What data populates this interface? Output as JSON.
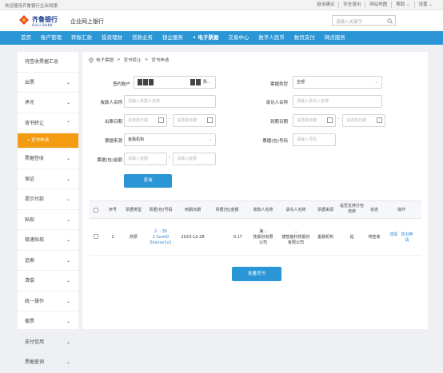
{
  "topbar": {
    "welcome": "欢迎使用齐鲁银行企业网银",
    "links": [
      "投诉建议",
      "安全退出",
      "网站地图",
      "帮助 ⌄",
      "设置 ⌄"
    ]
  },
  "brand": {
    "name_cn": "齐鲁银行",
    "name_en": "QILU BANK",
    "site_title": "企业网上银行",
    "search_placeholder": "请输入关键字"
  },
  "nav": {
    "items": [
      "首页",
      "账户管理",
      "转账汇款",
      "投资理财",
      "贷款业务",
      "银企服务",
      "• 电子票据",
      "交易中心",
      "数字人民币",
      "数贸支付",
      "网点服务"
    ],
    "active_index": 6
  },
  "sidebar": {
    "items": [
      {
        "label": "待签收票据汇总",
        "chev": ""
      },
      {
        "label": "出票",
        "chev": "⌄"
      },
      {
        "label": "承兑",
        "chev": "⌄"
      },
      {
        "label": "背书转让",
        "chev": "⌃"
      },
      {
        "label": "• 背书申请",
        "chev": "",
        "sub": true
      },
      {
        "label": "票据签收",
        "chev": "⌄"
      },
      {
        "label": "保证",
        "chev": "⌄"
      },
      {
        "label": "提示付款",
        "chev": "⌄"
      },
      {
        "label": "贴现",
        "chev": "⌄"
      },
      {
        "label": "极速贴现",
        "chev": "⌄"
      },
      {
        "label": "追索",
        "chev": "⌄"
      },
      {
        "label": "清偿",
        "chev": "⌄"
      },
      {
        "label": "统一操作",
        "chev": "⌄"
      },
      {
        "label": "撤票",
        "chev": "⌄"
      },
      {
        "label": "支付信用",
        "chev": "⌄"
      },
      {
        "label": "票据查询",
        "chev": "⌄"
      }
    ]
  },
  "breadcrumb": [
    "电子票据",
    "背书转让",
    "背书申请"
  ],
  "form": {
    "account_label": "签约账户",
    "account_value": "票...",
    "bill_type_label": "票据类型",
    "bill_type_value": "全部",
    "payee_label": "收款人名称",
    "payee_placeholder": "请输入收款人名称",
    "acceptor_label": "承兑人名称",
    "acceptor_placeholder": "请输入承兑人名称",
    "issue_date_label": "出票日期",
    "due_date_label": "到期日期",
    "date_placeholder": "请选择日期",
    "source_label": "票据来源",
    "source_value": "金融机构",
    "bill_no_label": "票据(包)号码",
    "bill_no_placeholder": "请输入号码",
    "amount_label": "票据(包)金额",
    "amount_placeholder": "请输入金额",
    "query_button": "查询"
  },
  "table": {
    "headers": [
      "序号",
      "票据类型",
      "票据(包)号码",
      "到期日期",
      "票据(包)金额",
      "收款人名称",
      "承兑人名称",
      "票据来源",
      "是否支持分包流转",
      "状态",
      "操作"
    ],
    "rows": [
      {
        "index": "1",
        "type": "商票",
        "bill_no": "2    ...30\n2    ilumi0\n0xxxxx1v1",
        "due_date": "2023-12-28",
        "amount": "0.17",
        "payee": "海...\n技股份有限\n公司",
        "acceptor": "...\n德智能科技股份\n有限公司",
        "source": "金融机构",
        "split": "是",
        "status": "待签收",
        "action_detail": "详情",
        "action_endorse": "背书申请"
      }
    ]
  },
  "batch_button": "批量背书"
}
